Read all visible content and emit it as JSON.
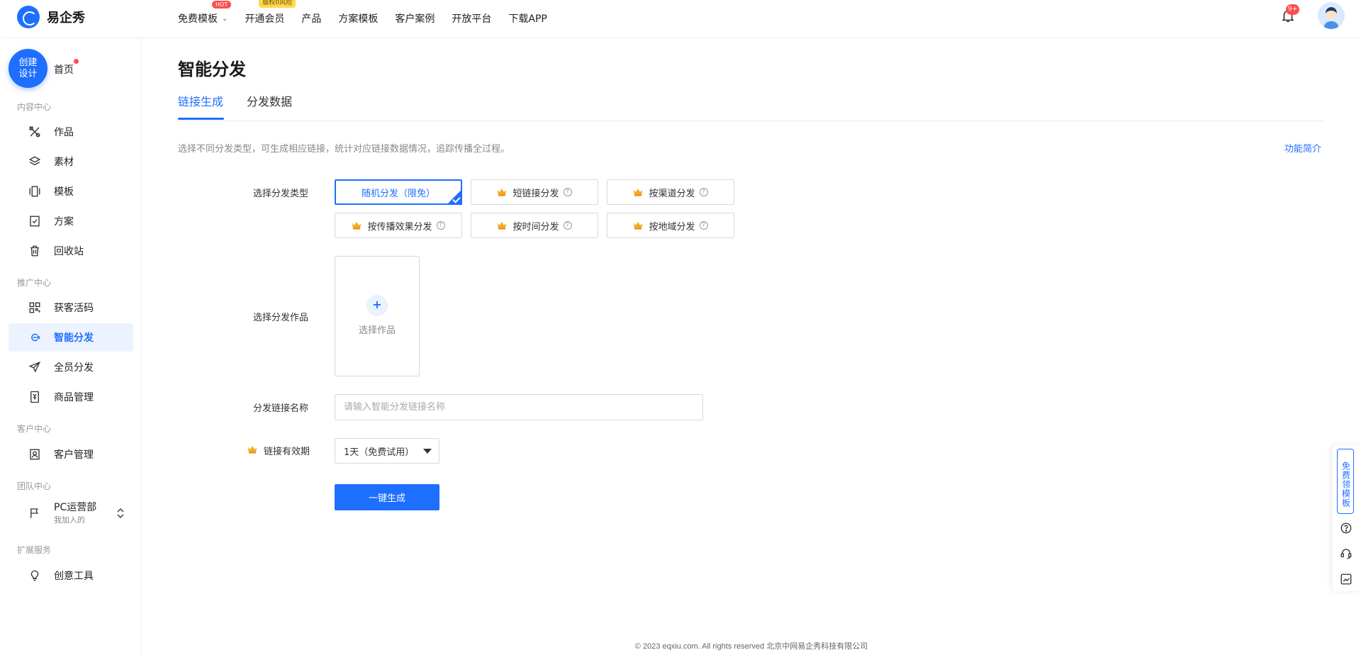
{
  "app": {
    "name": "易企秀"
  },
  "topnav": {
    "items": [
      {
        "label": "免费模板",
        "badge": "HOT"
      },
      {
        "label": "开通会员",
        "badge": "版权0风险"
      },
      {
        "label": "产品"
      },
      {
        "label": "方案模板"
      },
      {
        "label": "客户案例"
      },
      {
        "label": "开放平台"
      },
      {
        "label": "下载APP"
      }
    ],
    "notification_count": "9+"
  },
  "sidebar": {
    "create_label": "创建设计",
    "home_label": "首页",
    "sections": [
      {
        "title": "内容中心",
        "items": [
          "作品",
          "素材",
          "模板",
          "方案",
          "回收站"
        ]
      },
      {
        "title": "推广中心",
        "items": [
          "获客活码",
          "智能分发",
          "全员分发",
          "商品管理"
        ]
      },
      {
        "title": "客户中心",
        "items": [
          "客户管理"
        ]
      },
      {
        "title": "团队中心"
      },
      {
        "title": "扩展服务",
        "items": [
          "创意工具"
        ]
      }
    ],
    "active_item": "智能分发",
    "team": {
      "name": "PC运营部",
      "sub": "我加入的"
    }
  },
  "main": {
    "title": "智能分发",
    "tabs": [
      "链接生成",
      "分发数据"
    ],
    "active_tab": "链接生成",
    "description": "选择不同分发类型，可生成相应链接，统计对应链接数据情况，追踪传播全过程。",
    "intro_link": "功能简介",
    "form": {
      "type_label": "选择分发类型",
      "types": [
        {
          "label": "随机分发（限免）",
          "selected": true
        },
        {
          "label": "短链接分发"
        },
        {
          "label": "按渠道分发"
        },
        {
          "label": "按传播效果分发"
        },
        {
          "label": "按时间分发"
        },
        {
          "label": "按地域分发"
        }
      ],
      "work_label": "选择分发作品",
      "work_picker_label": "选择作品",
      "name_label": "分发链接名称",
      "name_placeholder": "请输入智能分发链接名称",
      "validity_label": "链接有效期",
      "validity_value": "1天（免费试用）",
      "submit_label": "一键生成"
    }
  },
  "footer": {
    "text": "© 2023 eqxiu.com. All rights reserved 北京中网易企秀科技有限公司"
  },
  "floatbar": {
    "free_template": "免费领模板"
  },
  "colors": {
    "primary": "#1e6fff",
    "danger": "#ff4d4f",
    "crown": "#f5a623"
  }
}
